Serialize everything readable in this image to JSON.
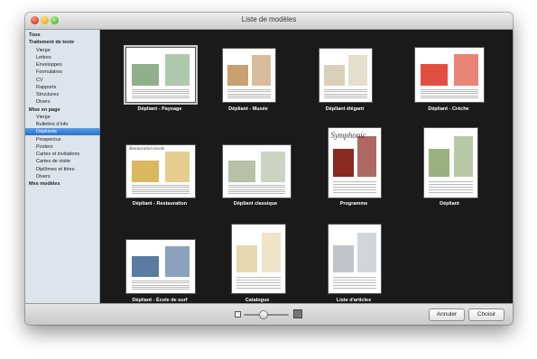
{
  "window": {
    "title": "Liste de modèles"
  },
  "sidebar": {
    "items": [
      {
        "label": "Tous",
        "level": "head",
        "selected": false
      },
      {
        "label": "Traitement de texte",
        "level": "head",
        "selected": false
      },
      {
        "label": "Vierge",
        "level": "sub",
        "selected": false
      },
      {
        "label": "Lettres",
        "level": "sub",
        "selected": false
      },
      {
        "label": "Enveloppes",
        "level": "sub",
        "selected": false
      },
      {
        "label": "Formulaires",
        "level": "sub",
        "selected": false
      },
      {
        "label": "CV",
        "level": "sub",
        "selected": false
      },
      {
        "label": "Rapports",
        "level": "sub",
        "selected": false
      },
      {
        "label": "Structures",
        "level": "sub",
        "selected": false
      },
      {
        "label": "Divers",
        "level": "sub",
        "selected": false
      },
      {
        "label": "Mise en page",
        "level": "head",
        "selected": false
      },
      {
        "label": "Vierge",
        "level": "sub",
        "selected": false
      },
      {
        "label": "Bulletins d’info",
        "level": "sub",
        "selected": false
      },
      {
        "label": "Dépliants",
        "level": "sub",
        "selected": true
      },
      {
        "label": "Prospectus",
        "level": "sub",
        "selected": false
      },
      {
        "label": "Posters",
        "level": "sub",
        "selected": false
      },
      {
        "label": "Cartes et invitations",
        "level": "sub",
        "selected": false
      },
      {
        "label": "Cartes de visite",
        "level": "sub",
        "selected": false
      },
      {
        "label": "Diplômes et titres",
        "level": "sub",
        "selected": false
      },
      {
        "label": "Divers",
        "level": "sub",
        "selected": false
      },
      {
        "label": "Mes modèles",
        "level": "head",
        "selected": false
      }
    ]
  },
  "gallery": {
    "templates": [
      {
        "label": "Dépliant - Paysage",
        "selected": true,
        "thumb_text": "",
        "thumb_color": "#8fb08a"
      },
      {
        "label": "Dépliant - Musée",
        "selected": false,
        "thumb_text": "",
        "thumb_color": "#c9a070"
      },
      {
        "label": "Dépliant élégant",
        "selected": false,
        "thumb_text": "",
        "thumb_color": "#d8d0b8"
      },
      {
        "label": "Dépliant - Crèche",
        "selected": false,
        "thumb_text": "",
        "thumb_color": "#e05040"
      },
      {
        "label": "Dépliant - Restauration",
        "selected": false,
        "thumb_text": "Restauration locale",
        "thumb_color": "#d9b860"
      },
      {
        "label": "Dépliant classique",
        "selected": false,
        "thumb_text": "",
        "thumb_color": "#b8c0a8"
      },
      {
        "label": "Programme",
        "selected": false,
        "thumb_text": "Symphonic",
        "thumb_color": "#8a2a20"
      },
      {
        "label": "Dépliant",
        "selected": false,
        "thumb_text": "",
        "thumb_color": "#9ab080"
      },
      {
        "label": "Dépliant - École de surf",
        "selected": false,
        "thumb_text": "",
        "thumb_color": "#5a7aa0"
      },
      {
        "label": "Catalogue",
        "selected": false,
        "thumb_text": "",
        "thumb_color": "#e8d8b0"
      },
      {
        "label": "Liste d'articles",
        "selected": false,
        "thumb_text": "",
        "thumb_color": "#c0c4c8"
      }
    ]
  },
  "footer": {
    "cancel_label": "Annuler",
    "choose_label": "Choisir",
    "zoom_level": 0.42
  }
}
